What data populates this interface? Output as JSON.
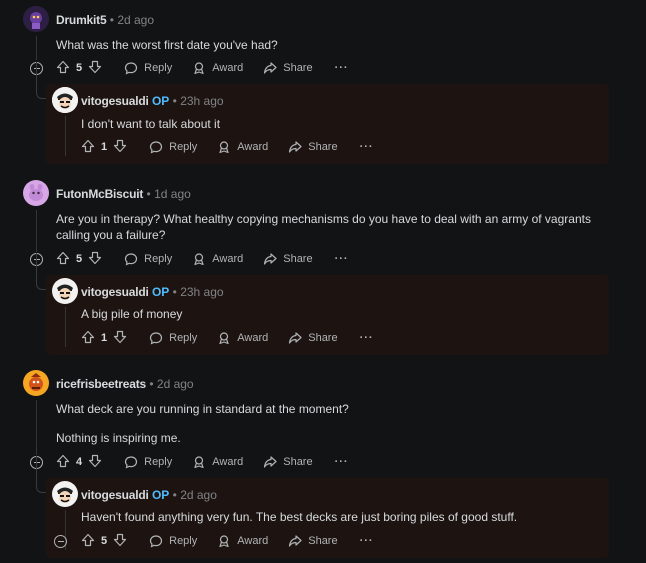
{
  "actions": {
    "reply": "Reply",
    "award": "Award",
    "share": "Share",
    "more": "···"
  },
  "op_badge": "OP",
  "comments": [
    {
      "user": "Drumkit5",
      "time": "2d ago",
      "text": [
        "What was the worst first date you've had?"
      ],
      "votes": "5",
      "reply": {
        "user": "vitogesualdi",
        "time": "23h ago",
        "text": [
          "I don't want to talk about it"
        ],
        "votes": "1"
      }
    },
    {
      "user": "FutonMcBiscuit",
      "time": "1d ago",
      "text": [
        "Are you in therapy? What healthy copying mechanisms do you have to deal with an army of vagrants calling you a failure?"
      ],
      "votes": "5",
      "reply": {
        "user": "vitogesualdi",
        "time": "23h ago",
        "text": [
          "A big pile of money"
        ],
        "votes": "1"
      }
    },
    {
      "user": "ricefrisbeetreats",
      "time": "2d ago",
      "text": [
        "What deck are you running in standard at the moment?",
        "Nothing is inspiring me."
      ],
      "votes": "4",
      "reply": {
        "user": "vitogesualdi",
        "time": "2d ago",
        "text": [
          "Haven't found anything very fun. The best decks are just boring piles of good stuff."
        ],
        "votes": "5"
      }
    }
  ],
  "colors": {
    "bg": "#121314",
    "reply_bg": "#1d1412",
    "op": "#4fbcff",
    "text": "#d7dadc",
    "muted": "#818384"
  }
}
